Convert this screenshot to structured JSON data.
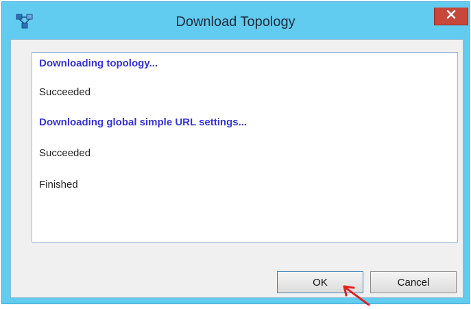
{
  "window": {
    "title": "Download Topology",
    "close_symbol": "✕",
    "title_bar_color": "#62ccf0"
  },
  "log": {
    "lines": [
      {
        "text": "Downloading topology...",
        "kind": "heading"
      },
      {
        "text": "Succeeded",
        "kind": "status"
      },
      {
        "text": "Downloading global simple URL settings...",
        "kind": "heading"
      },
      {
        "text": "Succeeded",
        "kind": "status"
      },
      {
        "text": "Finished",
        "kind": "status"
      }
    ],
    "heading_color": "#3434d8"
  },
  "buttons": {
    "ok_label": "OK",
    "cancel_label": "Cancel"
  },
  "icons": {
    "app": "topology-icon",
    "close": "close-icon",
    "pointer": "red-arrow-icon"
  },
  "annotation": {
    "arrow_color": "#e02020"
  }
}
